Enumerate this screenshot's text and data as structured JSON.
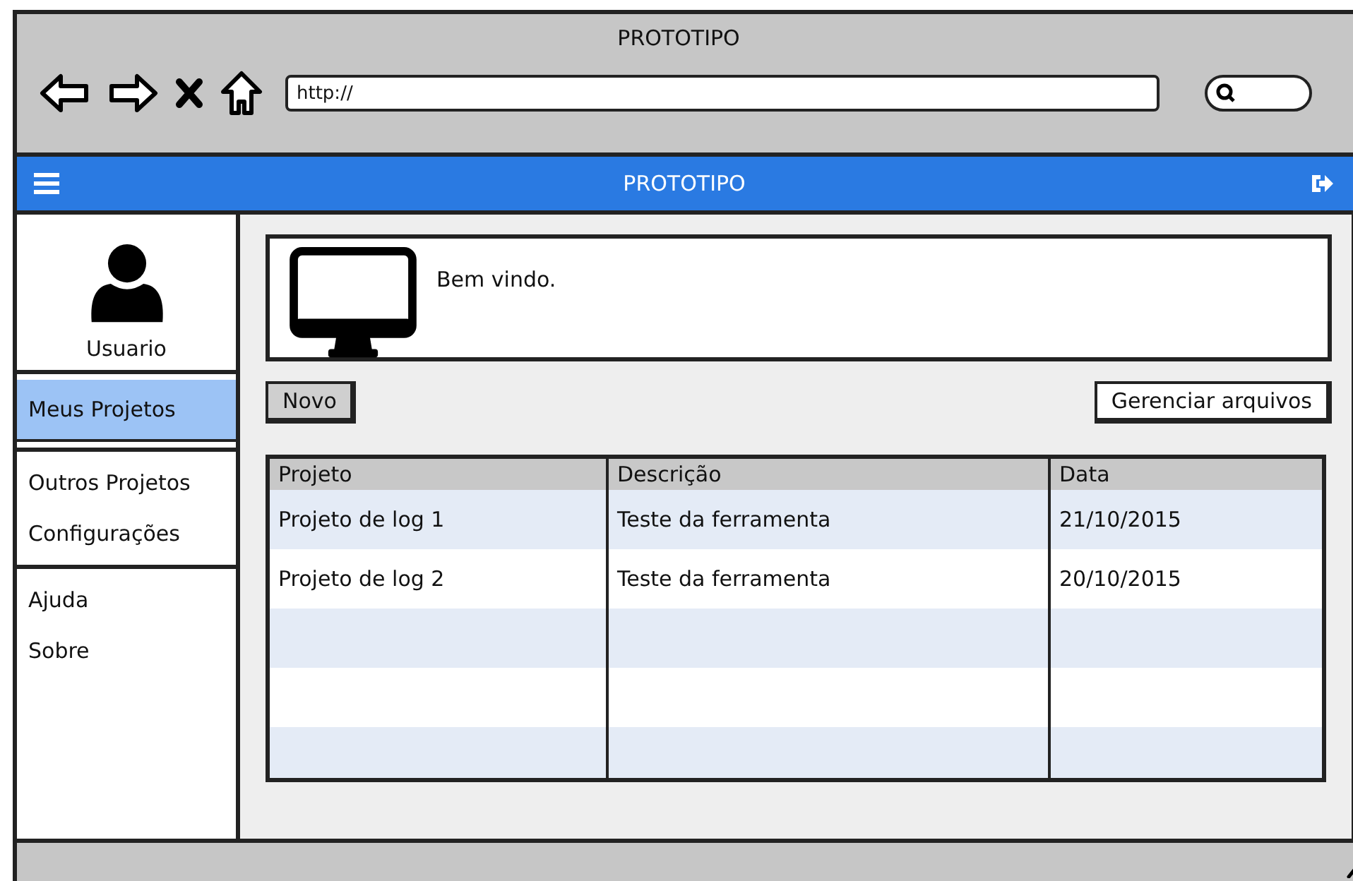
{
  "window": {
    "title": "PROTOTIPO"
  },
  "browser": {
    "url": "http://"
  },
  "app_bar": {
    "title": "PROTOTIPO"
  },
  "sidebar": {
    "user": "Usuario",
    "sections": [
      {
        "items": [
          {
            "label": "Meus Projetos",
            "selected": true
          }
        ]
      },
      {
        "items": [
          {
            "label": "Outros Projetos",
            "selected": false
          },
          {
            "label": "Configurações",
            "selected": false
          }
        ]
      },
      {
        "items": [
          {
            "label": "Ajuda",
            "selected": false
          },
          {
            "label": "Sobre",
            "selected": false
          }
        ]
      }
    ]
  },
  "welcome": {
    "text": "Bem vindo."
  },
  "buttons": [
    {
      "label": "Novo",
      "kind": "grey"
    },
    {
      "label": "Gerenciar arquivos",
      "kind": "white"
    }
  ],
  "table": {
    "columns": [
      "Projeto",
      "Descrição",
      "Data"
    ],
    "rows": [
      [
        "Projeto de log 1",
        "Teste da ferramenta",
        "21/10/2015"
      ],
      [
        "Projeto de log 2",
        "Teste da ferramenta",
        "20/10/2015"
      ]
    ]
  }
}
